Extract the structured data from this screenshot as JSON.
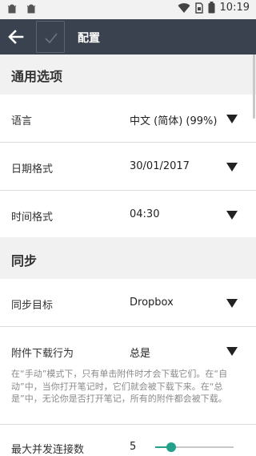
{
  "status_bar": {
    "time": "10:19",
    "icons_left": [
      "android-debug-icon",
      "android-debug-icon"
    ],
    "icons_right": [
      "wifi-icon",
      "sim-icon",
      "battery-icon"
    ]
  },
  "app_bar": {
    "title": "配置",
    "icons": [
      "back-arrow-icon",
      "checkmark-icon"
    ]
  },
  "sections": {
    "general": {
      "title": "通用选项",
      "language": {
        "label": "语言",
        "value": "中文 (简体) (99%)"
      },
      "date_format": {
        "label": "日期格式",
        "value": "30/01/2017"
      },
      "time_format": {
        "label": "时间格式",
        "value": "04:30"
      }
    },
    "sync": {
      "title": "同步",
      "target": {
        "label": "同步目标",
        "value": "Dropbox"
      },
      "attachment_download": {
        "label": "附件下载行为",
        "value": "总是",
        "help": "在“手动”模式下，只有单击附件时才会下载它们。在“自动”中，当你打开笔记时，它们就会被下载下来。在“总是”中，无论你是否打开笔记，所有的附件都会被下载。"
      },
      "max_connections": {
        "label": "最大并发连接数",
        "value": "5",
        "level_fraction": 0.2
      }
    }
  },
  "colors": {
    "app_bar": "#3a4250",
    "section_header_bg": "#f1f1f1",
    "accent": "#25a18b"
  }
}
